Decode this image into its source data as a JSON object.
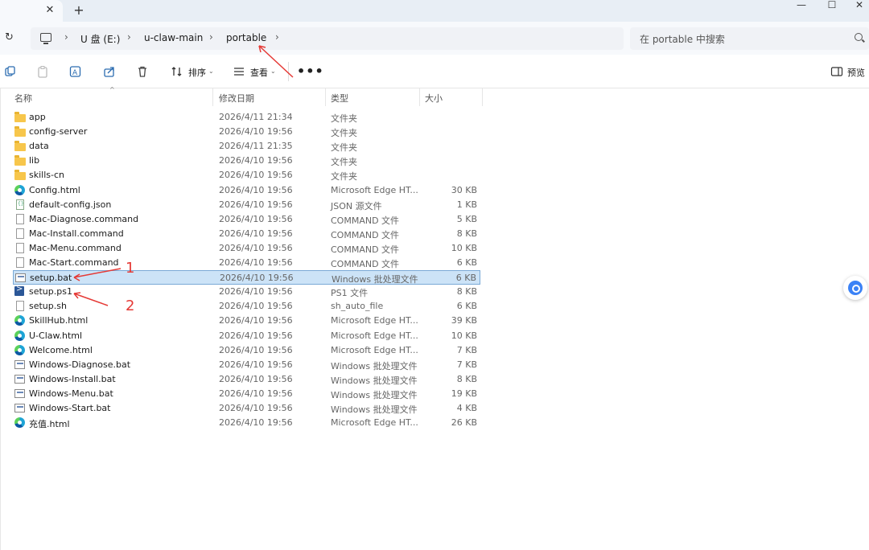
{
  "tab": {
    "close": "✕",
    "new": "+"
  },
  "window": {
    "minimize": "—",
    "maximize": "☐",
    "close": "✕"
  },
  "address": {
    "crumbs": [
      "U 盘 (E:)",
      "u-claw-main",
      "portable"
    ],
    "separator": "›"
  },
  "search": {
    "placeholder": "在 portable 中搜索"
  },
  "toolbar": {
    "sort_label": "排序",
    "view_label": "查看",
    "more": "•••",
    "preview_label": "预览"
  },
  "columns": {
    "name": "名称",
    "date": "修改日期",
    "type": "类型",
    "size": "大小"
  },
  "files": [
    {
      "name": "app",
      "date": "2026/4/11 21:34",
      "type": "文件夹",
      "size": "",
      "icon": "folder"
    },
    {
      "name": "config-server",
      "date": "2026/4/10 19:56",
      "type": "文件夹",
      "size": "",
      "icon": "folder"
    },
    {
      "name": "data",
      "date": "2026/4/11 21:35",
      "type": "文件夹",
      "size": "",
      "icon": "folder"
    },
    {
      "name": "lib",
      "date": "2026/4/10 19:56",
      "type": "文件夹",
      "size": "",
      "icon": "folder"
    },
    {
      "name": "skills-cn",
      "date": "2026/4/10 19:56",
      "type": "文件夹",
      "size": "",
      "icon": "folder"
    },
    {
      "name": "Config.html",
      "date": "2026/4/10 19:56",
      "type": "Microsoft Edge HT...",
      "size": "30 KB",
      "icon": "edge"
    },
    {
      "name": "default-config.json",
      "date": "2026/4/10 19:56",
      "type": "JSON 源文件",
      "size": "1 KB",
      "icon": "json"
    },
    {
      "name": "Mac-Diagnose.command",
      "date": "2026/4/10 19:56",
      "type": "COMMAND 文件",
      "size": "5 KB",
      "icon": "doc"
    },
    {
      "name": "Mac-Install.command",
      "date": "2026/4/10 19:56",
      "type": "COMMAND 文件",
      "size": "8 KB",
      "icon": "doc"
    },
    {
      "name": "Mac-Menu.command",
      "date": "2026/4/10 19:56",
      "type": "COMMAND 文件",
      "size": "10 KB",
      "icon": "doc"
    },
    {
      "name": "Mac-Start.command",
      "date": "2026/4/10 19:56",
      "type": "COMMAND 文件",
      "size": "6 KB",
      "icon": "doc"
    },
    {
      "name": "setup.bat",
      "date": "2026/4/10 19:56",
      "type": "Windows 批处理文件",
      "size": "6 KB",
      "icon": "bat"
    },
    {
      "name": "setup.ps1",
      "date": "2026/4/10 19:56",
      "type": "PS1 文件",
      "size": "8 KB",
      "icon": "ps1"
    },
    {
      "name": "setup.sh",
      "date": "2026/4/10 19:56",
      "type": "sh_auto_file",
      "size": "6 KB",
      "icon": "doc"
    },
    {
      "name": "SkillHub.html",
      "date": "2026/4/10 19:56",
      "type": "Microsoft Edge HT...",
      "size": "39 KB",
      "icon": "edge"
    },
    {
      "name": "U-Claw.html",
      "date": "2026/4/10 19:56",
      "type": "Microsoft Edge HT...",
      "size": "10 KB",
      "icon": "edge"
    },
    {
      "name": "Welcome.html",
      "date": "2026/4/10 19:56",
      "type": "Microsoft Edge HT...",
      "size": "7 KB",
      "icon": "edge"
    },
    {
      "name": "Windows-Diagnose.bat",
      "date": "2026/4/10 19:56",
      "type": "Windows 批处理文件",
      "size": "7 KB",
      "icon": "bat"
    },
    {
      "name": "Windows-Install.bat",
      "date": "2026/4/10 19:56",
      "type": "Windows 批处理文件",
      "size": "8 KB",
      "icon": "bat"
    },
    {
      "name": "Windows-Menu.bat",
      "date": "2026/4/10 19:56",
      "type": "Windows 批处理文件",
      "size": "19 KB",
      "icon": "bat"
    },
    {
      "name": "Windows-Start.bat",
      "date": "2026/4/10 19:56",
      "type": "Windows 批处理文件",
      "size": "4 KB",
      "icon": "bat"
    },
    {
      "name": "充值.html",
      "date": "2026/4/10 19:56",
      "type": "Microsoft Edge HT...",
      "size": "26 KB",
      "icon": "edge"
    }
  ],
  "selected_index": 11,
  "annotations": {
    "one": "1",
    "two": "2"
  },
  "colors": {
    "annotation": "#e53935",
    "selection": "#cce3f7",
    "accent": "#3b82f6"
  }
}
